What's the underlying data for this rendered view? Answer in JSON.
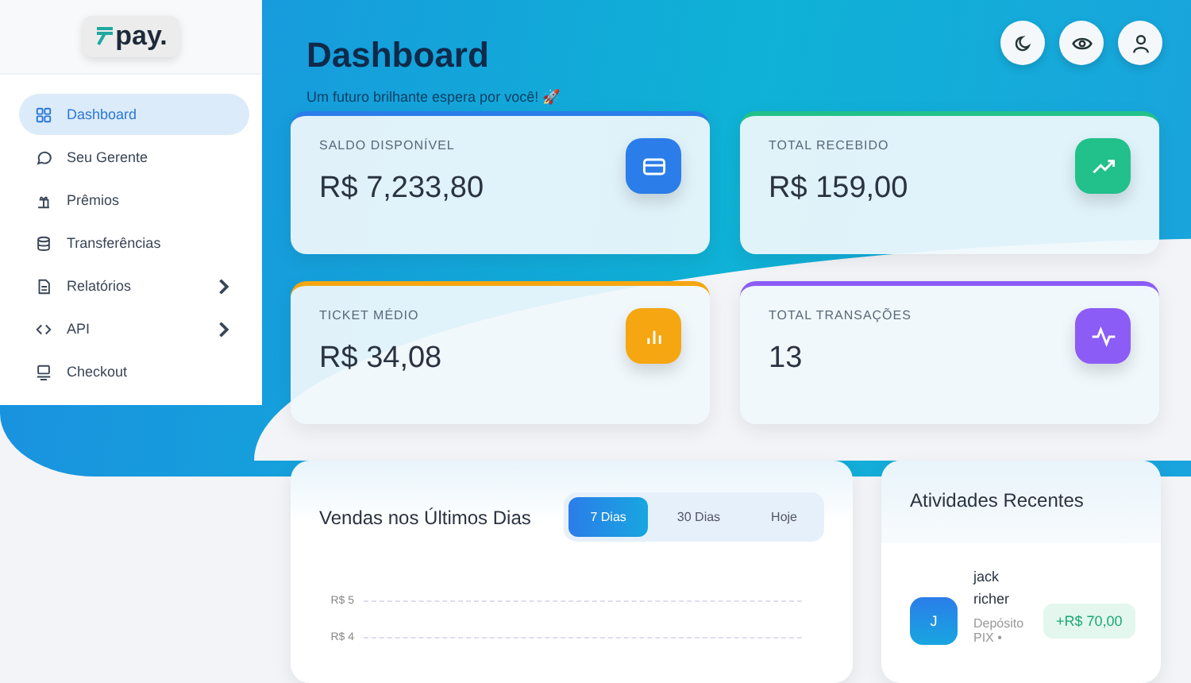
{
  "sidebar": {
    "logo": "pay.",
    "items": [
      {
        "label": "Dashboard",
        "selected": true,
        "expandable": false
      },
      {
        "label": "Seu Gerente",
        "selected": false,
        "expandable": false
      },
      {
        "label": "Prêmios",
        "selected": false,
        "expandable": false
      },
      {
        "label": "Transferências",
        "selected": false,
        "expandable": false
      },
      {
        "label": "Relatórios",
        "selected": false,
        "expandable": true
      },
      {
        "label": "API",
        "selected": false,
        "expandable": true
      },
      {
        "label": "Checkout",
        "selected": false,
        "expandable": false
      }
    ]
  },
  "header": {
    "title": "Dashboard",
    "subtitle": "Um futuro brilhante espera por você! 🚀"
  },
  "stats": [
    {
      "label": "SALDO DISPONÍVEL",
      "value": "R$ 7,233,80",
      "color": "#2b7de9"
    },
    {
      "label": "TOTAL RECEBIDO",
      "value": "R$ 159,00",
      "color": "#22c08a"
    },
    {
      "label": "TICKET MÉDIO",
      "value": "R$ 34,08",
      "color": "#f5a611"
    },
    {
      "label": "TOTAL TRANSAÇÕES",
      "value": "13",
      "color": "#8b5cf6"
    }
  ],
  "sales": {
    "title": "Vendas nos Últimos Dias",
    "tabs": [
      {
        "label": "7 Dias",
        "selected": true
      },
      {
        "label": "30 Dias",
        "selected": false
      },
      {
        "label": "Hoje",
        "selected": false
      }
    ],
    "y_tick_labels": [
      "R$ 5",
      "R$ 4"
    ]
  },
  "activity": {
    "title": "Atividades Recentes",
    "items": [
      {
        "initial": "J",
        "name": "jack richer",
        "description": "Depósito PIX •",
        "amount": "+R$ 70,00"
      }
    ]
  }
}
